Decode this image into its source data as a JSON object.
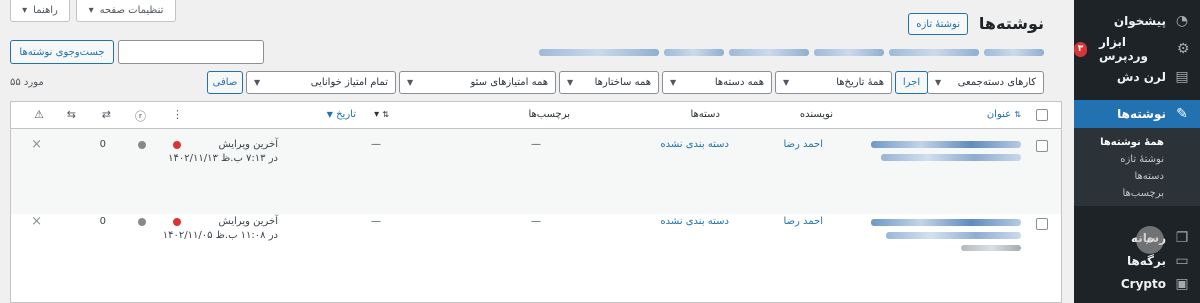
{
  "sidebar": {
    "items": [
      {
        "label": "پیشخوان",
        "icon": "dashboard-icon"
      },
      {
        "label": "ابزار وردپرس",
        "icon": "wordpress-tools-icon",
        "badge": "۳"
      },
      {
        "label": "لرن دش",
        "icon": "learndash-icon"
      },
      {
        "label": "نوشته‌ها",
        "icon": "pin-icon"
      }
    ],
    "submenu": [
      "همهٔ نوشته‌ها",
      "نوشتهٔ تازه",
      "دسته‌ها",
      "برچسب‌ها"
    ],
    "bottom": [
      {
        "label": "رسانه",
        "icon": "media-icon"
      },
      {
        "label": "برگه‌ها",
        "icon": "pages-icon"
      },
      {
        "label": "Crypto",
        "icon": "crypto-icon"
      }
    ]
  },
  "top_tabs": {
    "screen_options": "تنظیمات صفحه",
    "help": "راهنما"
  },
  "header": {
    "title": "نوشته‌ها",
    "add_new": "نوشتهٔ تازه"
  },
  "search": {
    "button": "جست‌وجوی نوشته‌ها",
    "value": ""
  },
  "filters": {
    "bulk_actions": "کارهای دسته‌جمعی",
    "apply": "اجرا",
    "dates": "همهٔ تاریخ‌ها",
    "categories": "همه دسته‌ها",
    "structures": "همه ساختارها",
    "seo": "همه امتیازهای سئو",
    "readability": "تمام امتیاز خوانایی",
    "filter": "صافی",
    "count": "۵۵ مورد"
  },
  "table": {
    "headers": {
      "title": "عنوان",
      "author": "نویسنده",
      "categories": "دسته‌ها",
      "tags": "برچسب‌ها",
      "date": "تاریخ"
    },
    "rows": [
      {
        "author": "احمد رضا",
        "category": "دسته بندی نشده",
        "tags": "—",
        "comments": "—",
        "date_label": "آخرین ویرایش",
        "date_value": "۱۴۰۲/۱۱/۱۳ در ۷:۱۳ ب.ظ",
        "links": "0"
      },
      {
        "author": "احمد رضا",
        "category": "دسته بندی نشده",
        "tags": "—",
        "comments": "—",
        "date_label": "آخرین ویرایش",
        "date_value": "۱۴۰۲/۱۱/۰۵ در ۱۱:۰۸ ب.ظ",
        "links": "0"
      }
    ]
  },
  "colors": {
    "accent": "#2271b1",
    "sidebar": "#1d2327",
    "seo_bad": "#dc3232",
    "readability_none": "#888888"
  }
}
